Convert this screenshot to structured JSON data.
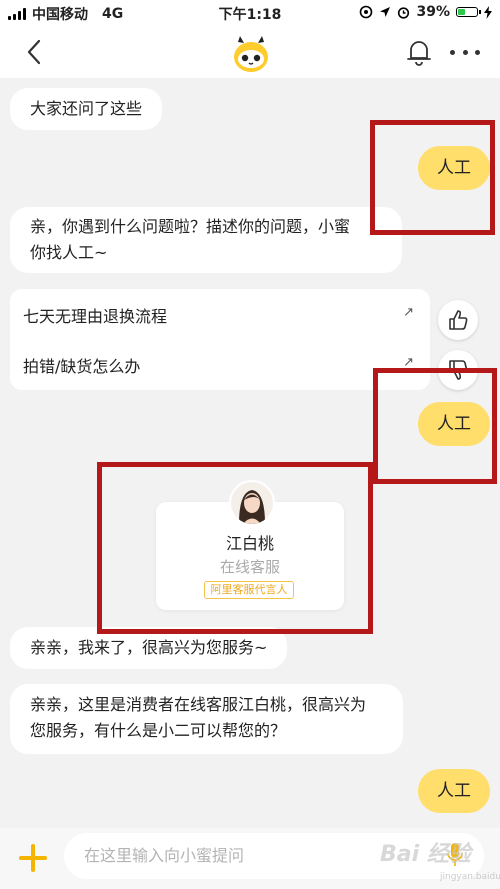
{
  "status_bar": {
    "carrier": "中国移动",
    "network": "4G",
    "time": "下午1:18",
    "battery": "39%",
    "battery_level": 0.39,
    "battery_color": "#2bc84a"
  },
  "nav": {
    "back_icon": "chevron-left-icon",
    "logo_icon": "mascot-icon",
    "bell_icon": "bell-icon",
    "more_icon": "more-icon"
  },
  "messages": {
    "also_asked": "大家还问了这些",
    "human_1": "人工",
    "prompt_line1": "亲，你遇到什么问题啦？描述你的问题，小蜜",
    "prompt_line2": "你找人工~",
    "human_2": "人工",
    "greeting": "亲亲，我来了，很高兴为您服务~",
    "intro_line1": "亲亲，这里是消费者在线客服江白桃，很高兴为",
    "intro_line2": "您服务，有什么是小二可以帮您的？",
    "human_3": "人工"
  },
  "faq": {
    "items": [
      {
        "label": "七天无理由退换流程"
      },
      {
        "label": "拍错/缺货怎么办"
      }
    ]
  },
  "agent": {
    "name": "江白桃",
    "role": "在线客服",
    "badge": "阿里客服代言人"
  },
  "input": {
    "placeholder": "在这里输入向小蜜提问"
  },
  "watermark": {
    "text": "Bai 经验",
    "sub": "jingyan.baidu.com"
  },
  "colors": {
    "accent": "#ffde6b",
    "highlight_box": "#b51818",
    "badge": "#f0a91d"
  }
}
